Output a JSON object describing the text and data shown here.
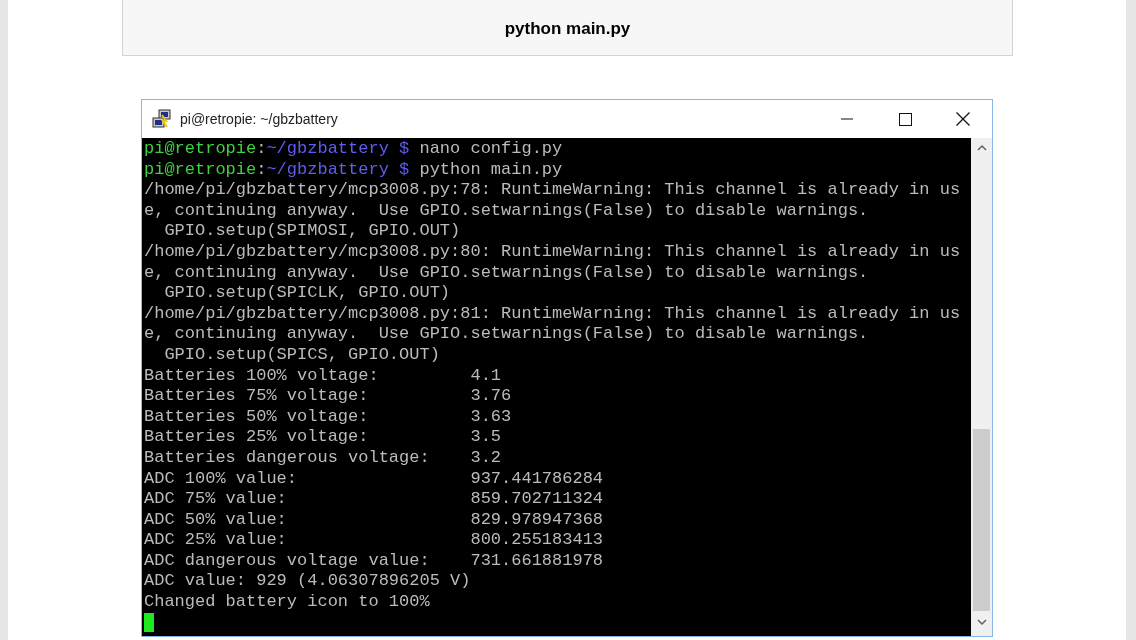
{
  "code_box": {
    "text": "python main.py"
  },
  "window": {
    "title": "pi@retropie: ~/gbzbattery"
  },
  "terminal": {
    "lines": [
      {
        "kind": "prompt",
        "user": "pi@retropie",
        "separator": ":",
        "path": "~/gbzbattery $",
        "command": " nano config.py"
      },
      {
        "kind": "prompt",
        "user": "pi@retropie",
        "separator": ":",
        "path": "~/gbzbattery $",
        "command": " python main.py"
      },
      {
        "kind": "output",
        "text": "/home/pi/gbzbattery/mcp3008.py:78: RuntimeWarning: This channel is already in us"
      },
      {
        "kind": "output",
        "text": "e, continuing anyway.  Use GPIO.setwarnings(False) to disable warnings."
      },
      {
        "kind": "output",
        "text": "  GPIO.setup(SPIMOSI, GPIO.OUT)"
      },
      {
        "kind": "output",
        "text": "/home/pi/gbzbattery/mcp3008.py:80: RuntimeWarning: This channel is already in us"
      },
      {
        "kind": "output",
        "text": "e, continuing anyway.  Use GPIO.setwarnings(False) to disable warnings."
      },
      {
        "kind": "output",
        "text": "  GPIO.setup(SPICLK, GPIO.OUT)"
      },
      {
        "kind": "output",
        "text": "/home/pi/gbzbattery/mcp3008.py:81: RuntimeWarning: This channel is already in us"
      },
      {
        "kind": "output",
        "text": "e, continuing anyway.  Use GPIO.setwarnings(False) to disable warnings."
      },
      {
        "kind": "output",
        "text": "  GPIO.setup(SPICS, GPIO.OUT)"
      },
      {
        "kind": "output",
        "text": "Batteries 100% voltage:         4.1"
      },
      {
        "kind": "output",
        "text": "Batteries 75% voltage:          3.76"
      },
      {
        "kind": "output",
        "text": "Batteries 50% voltage:          3.63"
      },
      {
        "kind": "output",
        "text": "Batteries 25% voltage:          3.5"
      },
      {
        "kind": "output",
        "text": "Batteries dangerous voltage:    3.2"
      },
      {
        "kind": "output",
        "text": "ADC 100% value:                 937.441786284"
      },
      {
        "kind": "output",
        "text": "ADC 75% value:                  859.702711324"
      },
      {
        "kind": "output",
        "text": "ADC 50% value:                  829.978947368"
      },
      {
        "kind": "output",
        "text": "ADC 25% value:                  800.255183413"
      },
      {
        "kind": "output",
        "text": "ADC dangerous voltage value:    731.661881978"
      },
      {
        "kind": "output",
        "text": "ADC value: 929 (4.06307896205 V)"
      },
      {
        "kind": "output",
        "text": "Changed battery icon to 100%"
      },
      {
        "kind": "cursor"
      }
    ]
  }
}
